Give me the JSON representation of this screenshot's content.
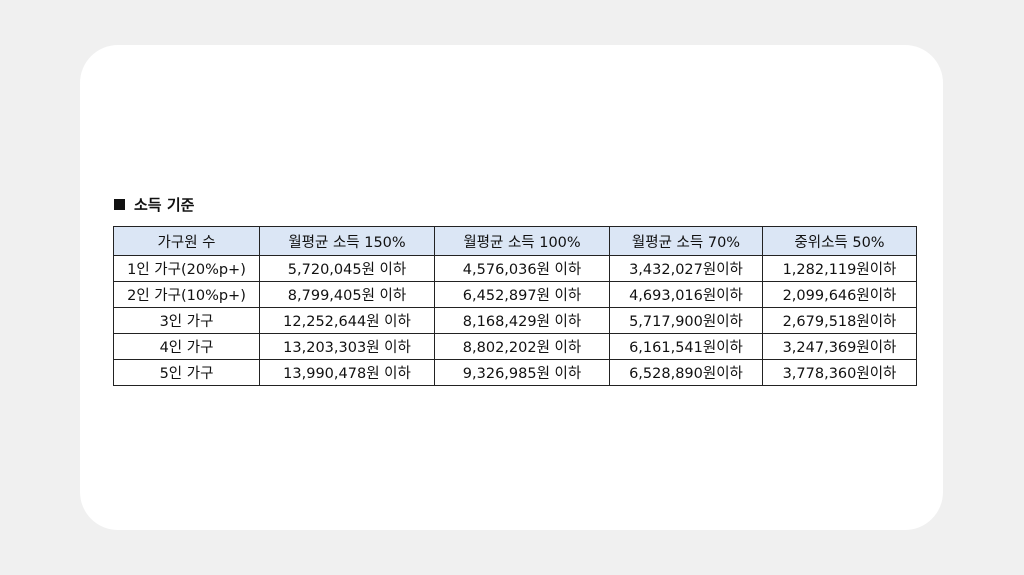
{
  "section": {
    "icon": "square-bullet-icon",
    "title": "소득 기준"
  },
  "table": {
    "headers": [
      "가구원 수",
      "월평균 소득 150%",
      "월평균 소득 100%",
      "월평균 소득 70%",
      "중위소득 50%"
    ],
    "rows": [
      [
        "1인 가구(20%p+)",
        "5,720,045원 이하",
        "4,576,036원 이하",
        "3,432,027원이하",
        "1,282,119원이하"
      ],
      [
        "2인 가구(10%p+)",
        "8,799,405원 이하",
        "6,452,897원 이하",
        "4,693,016원이하",
        "2,099,646원이하"
      ],
      [
        "3인 가구",
        "12,252,644원 이하",
        "8,168,429원 이하",
        "5,717,900원이하",
        "2,679,518원이하"
      ],
      [
        "4인 가구",
        "13,203,303원 이하",
        "8,802,202원 이하",
        "6,161,541원이하",
        "3,247,369원이하"
      ],
      [
        "5인 가구",
        "13,990,478원 이하",
        "9,326,985원 이하",
        "6,528,890원이하",
        "3,778,360원이하"
      ]
    ]
  },
  "colors": {
    "page_background": "#f0f0f0",
    "card_background": "#ffffff",
    "header_fill": "#dbe6f5",
    "border": "#222222"
  }
}
